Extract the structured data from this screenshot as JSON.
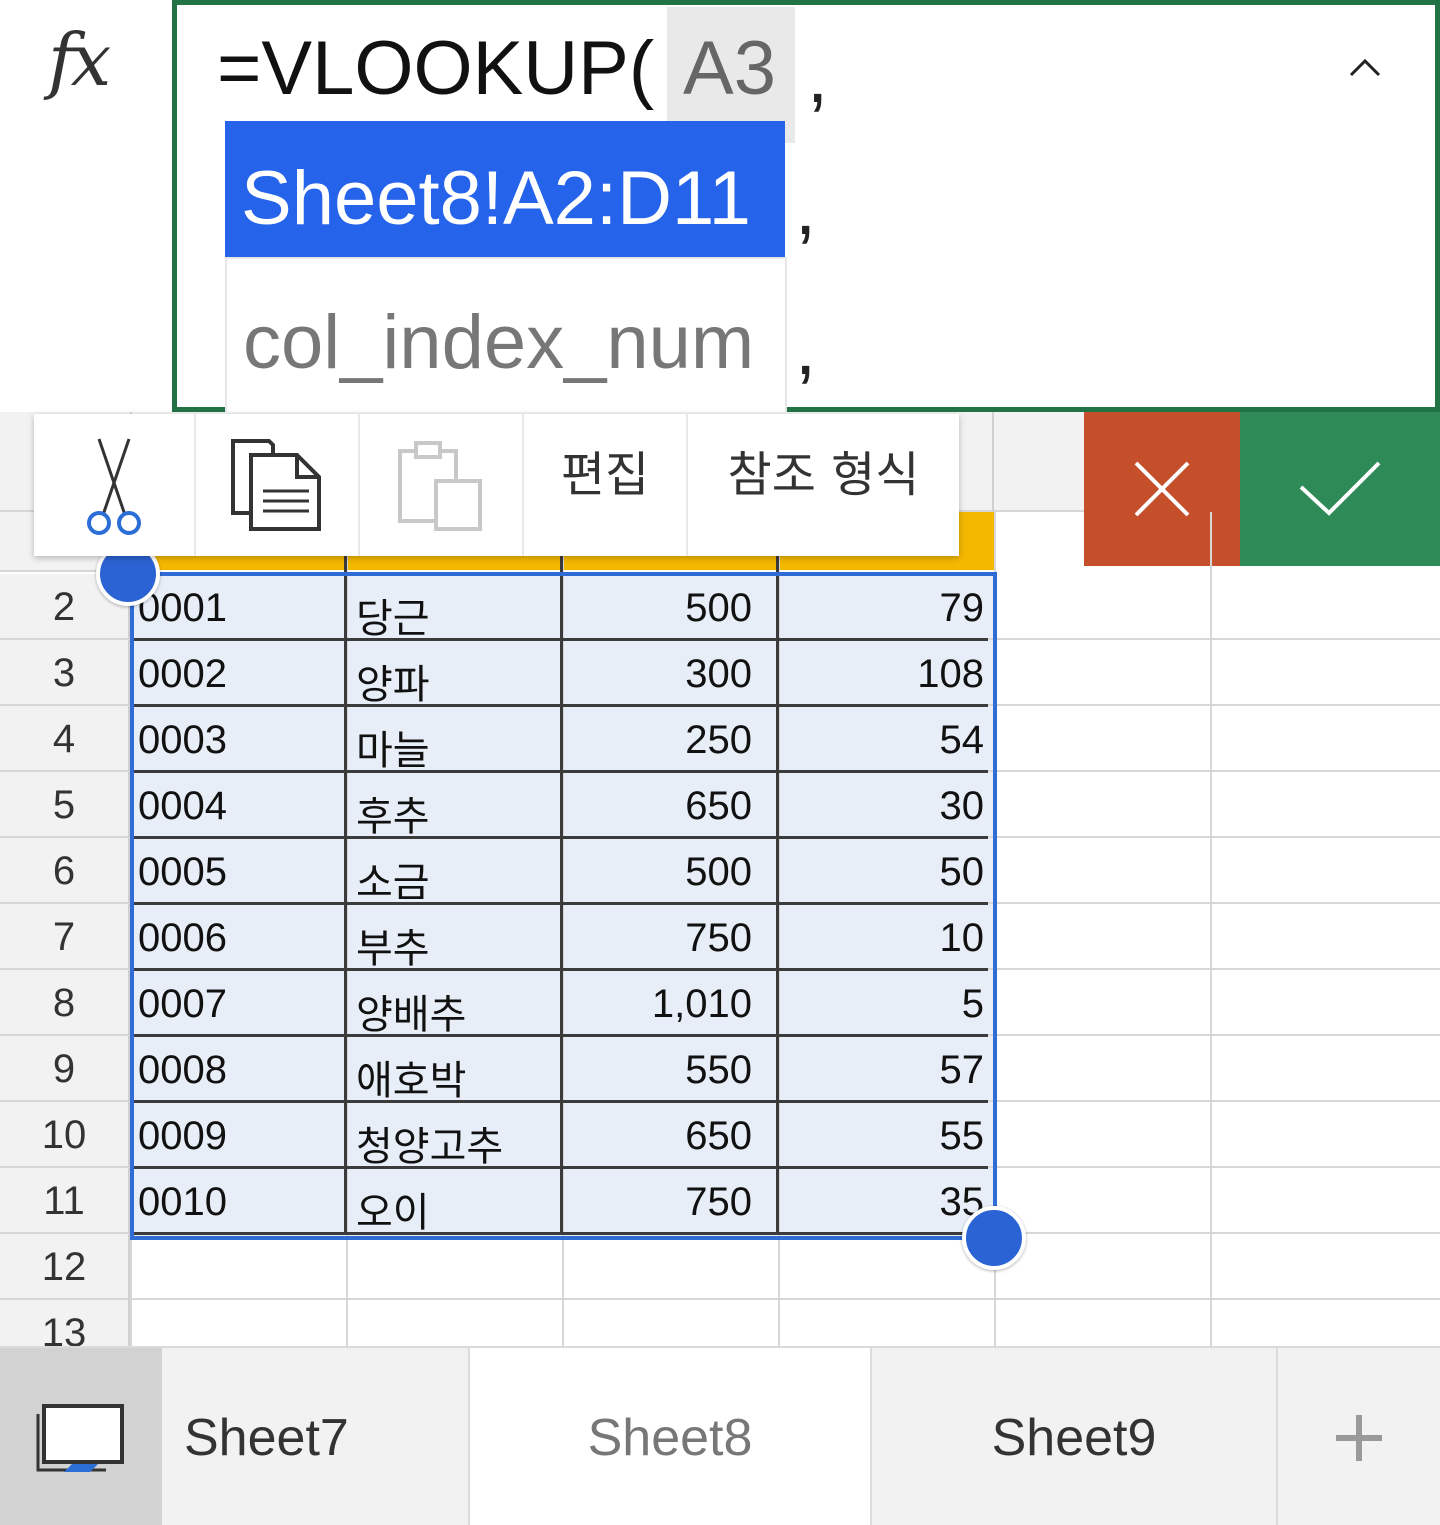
{
  "formula": {
    "fx_label": "fx",
    "prefix": "=VLOOKUP(",
    "arg_lookup": "A3",
    "separator": ",",
    "arg_range": "Sheet8!A2:D11",
    "arg_col": "col_index_num"
  },
  "menu": {
    "edit_label": "편집",
    "ref_label": "참조 형식"
  },
  "row_numbers": [
    "2",
    "3",
    "4",
    "5",
    "6",
    "7",
    "8",
    "9",
    "10",
    "11",
    "12",
    "13"
  ],
  "rows": [
    {
      "code": "0001",
      "name": "당근",
      "price": "500",
      "qty": "79"
    },
    {
      "code": "0002",
      "name": "양파",
      "price": "300",
      "qty": "108"
    },
    {
      "code": "0003",
      "name": "마늘",
      "price": "250",
      "qty": "54"
    },
    {
      "code": "0004",
      "name": "후추",
      "price": "650",
      "qty": "30"
    },
    {
      "code": "0005",
      "name": "소금",
      "price": "500",
      "qty": "50"
    },
    {
      "code": "0006",
      "name": "부추",
      "price": "750",
      "qty": "10"
    },
    {
      "code": "0007",
      "name": "양배추",
      "price": "1,010",
      "qty": "5"
    },
    {
      "code": "0008",
      "name": "애호박",
      "price": "550",
      "qty": "57"
    },
    {
      "code": "0009",
      "name": "청양고추",
      "price": "650",
      "qty": "55"
    },
    {
      "code": "0010",
      "name": "오이",
      "price": "750",
      "qty": "35"
    }
  ],
  "tabs": [
    {
      "label": "Sheet7",
      "active": false
    },
    {
      "label": "Sheet8",
      "active": true
    },
    {
      "label": "Sheet9",
      "active": false
    }
  ],
  "colors": {
    "accent_green": "#217346",
    "selection_blue": "#2563eb",
    "header_fill": "#f5b800",
    "cancel_red": "#c64f2b",
    "confirm_green": "#2e8b57"
  }
}
